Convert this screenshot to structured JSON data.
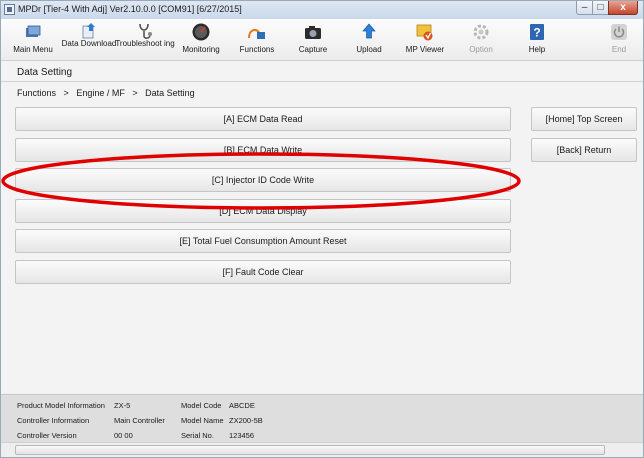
{
  "window": {
    "title": "MPDr [Tier-4 With Adj] Ver2.10.0.0 [COM91] [6/27/2015]",
    "min_glyph": "–",
    "max_glyph": "□",
    "close_glyph": "x"
  },
  "toolbar": {
    "main_menu": "Main Menu",
    "data_download": "Data Download",
    "troubleshooting": "Troubleshoot ing",
    "monitoring": "Monitoring",
    "functions": "Functions",
    "capture": "Capture",
    "upload": "Upload",
    "mp_viewer": "MP Viewer",
    "option": "Option",
    "help": "Help",
    "end": "End"
  },
  "page": {
    "title": "Data Setting",
    "breadcrumb": [
      "Functions",
      ">",
      "Engine / MF",
      ">",
      "Data Setting"
    ]
  },
  "menu": {
    "a": "[A] ECM Data Read",
    "b": "[B] ECM Data Write",
    "c": "[C] Injector ID Code Write",
    "d": "[D] ECM Data Display",
    "e": "[E] Total Fuel Consumption Amount Reset",
    "f": "[F] Fault Code Clear",
    "home": "[Home] Top Screen",
    "back": "[Back] Return"
  },
  "status": {
    "product_model_label": "Product Model Information",
    "product_model_value": "ZX-5",
    "controller_info_label": "Controller Information",
    "controller_info_value": "Main Controller",
    "controller_version_label": "Controller Version",
    "controller_version_value": "00 00",
    "model_code_label": "Model Code",
    "model_code_value": "ABCDE",
    "model_name_label": "Model Name",
    "model_name_value": "ZX200-5B",
    "serial_label": "Serial No.",
    "serial_value": "123456"
  },
  "highlight_color": "#e00000"
}
